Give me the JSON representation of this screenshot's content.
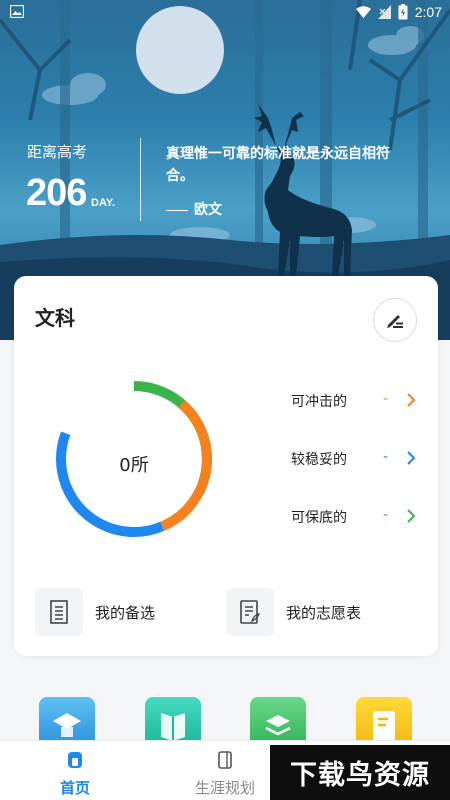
{
  "status_bar": {
    "time": "2:07"
  },
  "hero": {
    "countdown_label": "距离高考",
    "countdown_days": "206",
    "countdown_unit": "DAY.",
    "quote": "真理惟一可靠的标准就是永远自相符合。",
    "quote_author": "欧文"
  },
  "card": {
    "title": "文科",
    "center_text": "0所",
    "ring_colors": {
      "green": "#3bb54a",
      "orange": "#f5821f",
      "blue": "#1e88f0"
    },
    "categories": [
      {
        "label": "可冲击的",
        "value": "-",
        "color": "#f5821f"
      },
      {
        "label": "较稳妥的",
        "value": "-",
        "color": "#1e88f0"
      },
      {
        "label": "可保底的",
        "value": "-",
        "color": "#3bb54a"
      }
    ],
    "actions": [
      {
        "label": "我的备选",
        "icon": "list-icon"
      },
      {
        "label": "我的志愿表",
        "icon": "form-edit-icon"
      }
    ]
  },
  "features": [
    {
      "icon": "graduation-cap-icon",
      "color": "#3aa6e8"
    },
    {
      "icon": "book-icon",
      "color": "#26c6a6"
    },
    {
      "icon": "layers-icon",
      "color": "#4cc26a"
    },
    {
      "icon": "note-icon",
      "color": "#f5c518"
    }
  ],
  "tabs": [
    {
      "label": "首页",
      "active": true
    },
    {
      "label": "生涯规划",
      "active": false
    }
  ],
  "watermark": "下载鸟资源"
}
